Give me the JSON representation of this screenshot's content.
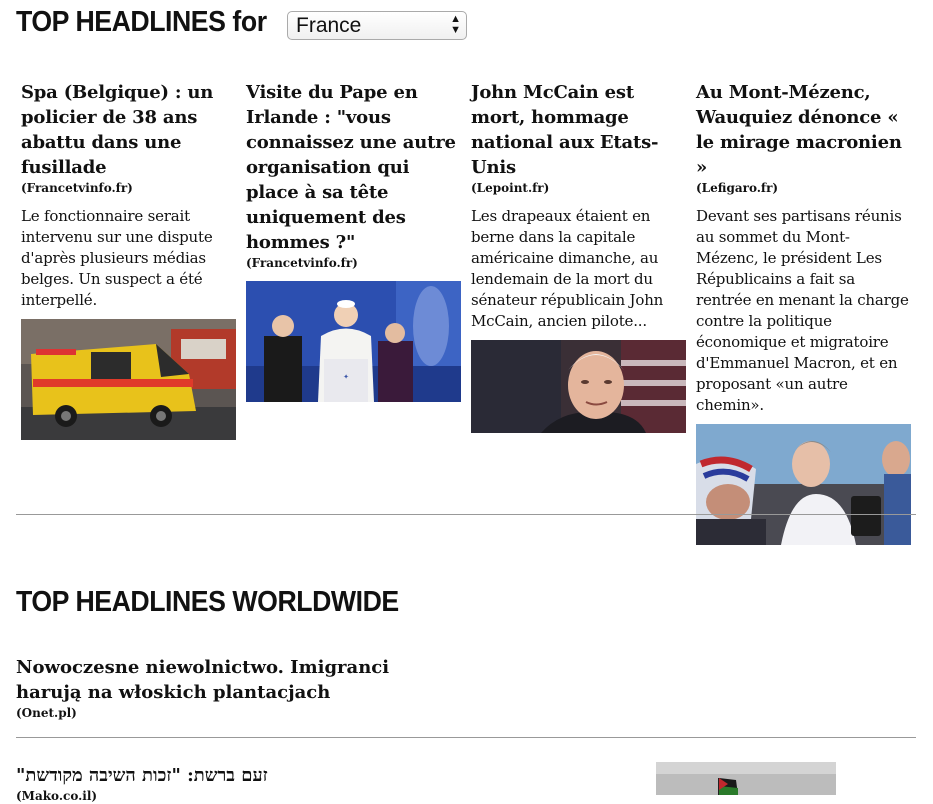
{
  "country_section": {
    "title": "TOP HEADLINES for",
    "selected_country": "France",
    "articles": [
      {
        "headline": "Spa (Belgique) : un policier de 38 ans abattu dans une fusillade",
        "source": "(Francetvinfo.fr)",
        "description": "Le fonctionnaire serait intervenu sur une dispute d'après plusieurs médias belges. Un suspect a été interpellé.",
        "image": "yellow-ambulance-photo"
      },
      {
        "headline": "Visite du Pape en Irlande : \"vous connaissez une autre organisation qui place à sa tête uniquement des hommes ?\"",
        "source": "(Francetvinfo.fr)",
        "description": "",
        "image": "pope-speech-photo"
      },
      {
        "headline": "John McCain est mort, hommage national aux Etats-Unis",
        "source": "(Lepoint.fr)",
        "description": "Les drapeaux étaient en berne dans la capitale américaine dimanche, au lendemain de la mort du sénateur républicain John McCain, ancien pilote...",
        "image": "mccain-portrait-photo"
      },
      {
        "headline": "Au Mont-Mézenc, Wauquiez dénonce « le mirage macronien »",
        "source": "(Lefigaro.fr)",
        "description": "Devant ses partisans réunis au sommet du Mont-Mézenc, le président Les Républicains a fait sa rentrée en menant la charge contre la politique économique et migratoire d'Emmanuel Macron, et en proposant «un autre chemin».",
        "image": "crowd-selfie-photo"
      }
    ]
  },
  "worldwide_section": {
    "title": "TOP HEADLINES WORLDWIDE",
    "articles": [
      {
        "headline": "Nowoczesne niewolnictwo. Imigranci harują na włoskich plantacjach",
        "source": "(Onet.pl)"
      },
      {
        "headline": "זעם ברשת: \"זכות השיבה מקודשת\"",
        "source": "(Mako.co.il)",
        "image": "flag-photo"
      }
    ]
  }
}
